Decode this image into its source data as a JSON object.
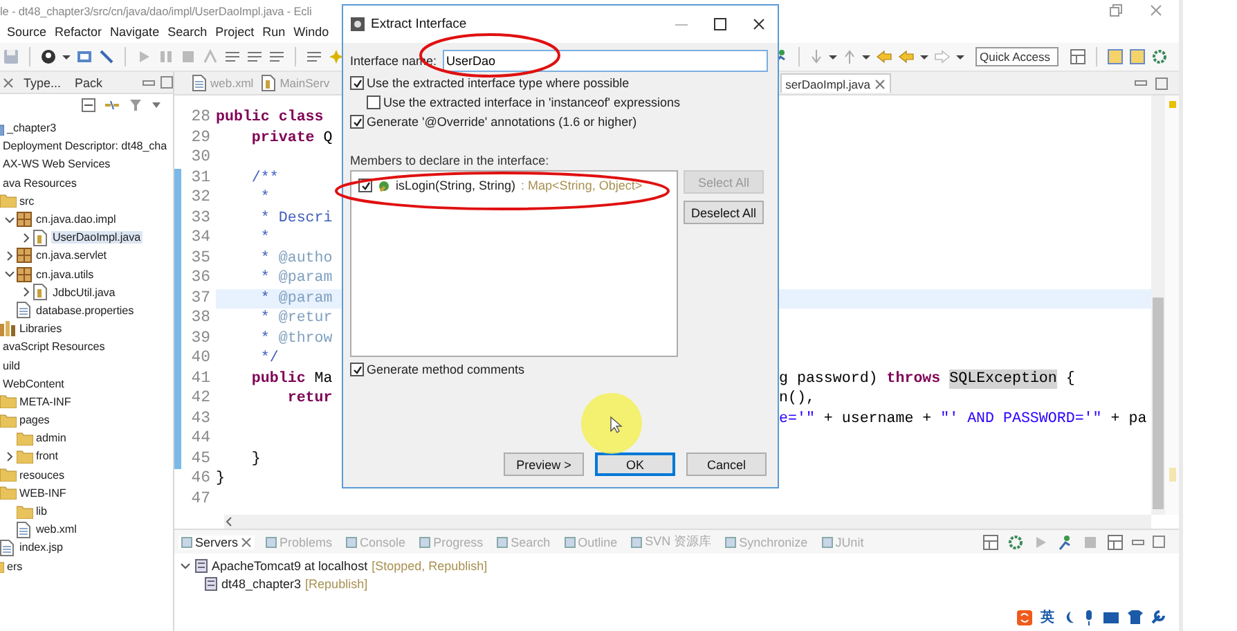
{
  "window": {
    "title": "le - dt48_chapter3/src/cn/java/dao/impl/UserDaoImpl.java - Ecli"
  },
  "menu": [
    "Source",
    "Refactor",
    "Navigate",
    "Search",
    "Project",
    "Run",
    "Windo"
  ],
  "toolbar": {
    "quick_access": {
      "placeholder": "Quick Access"
    }
  },
  "explorer": {
    "tabs": [
      {
        "label": "Type...",
        "selected": false
      },
      {
        "label": "Pack",
        "selected": false
      }
    ],
    "tree": [
      {
        "label": "_chapter3",
        "kind": "project",
        "selected": false,
        "children": [
          {
            "label": "Deployment Descriptor: dt48_cha",
            "selected": false
          },
          {
            "label": "AX-WS Web Services",
            "selected": false
          },
          {
            "label": "ava Resources",
            "selected": false,
            "children": [
              {
                "label": "src",
                "kind": "folder",
                "selected": false,
                "children": [
                  {
                    "label": "cn.java.dao.impl",
                    "kind": "package",
                    "expanded": true,
                    "selected": false,
                    "children": [
                      {
                        "label": "UserDaoImpl.java",
                        "kind": "java",
                        "expanded": false,
                        "selected": true
                      }
                    ]
                  },
                  {
                    "label": "cn.java.servlet",
                    "kind": "package",
                    "expanded": false,
                    "selected": false
                  },
                  {
                    "label": "cn.java.utils",
                    "kind": "package",
                    "expanded": true,
                    "selected": false,
                    "children": [
                      {
                        "label": "JdbcUtil.java",
                        "kind": "java",
                        "expanded": false,
                        "selected": false
                      }
                    ]
                  },
                  {
                    "label": "database.properties",
                    "kind": "document",
                    "selected": false
                  }
                ]
              },
              {
                "label": "Libraries",
                "kind": "library",
                "selected": false
              }
            ]
          },
          {
            "label": "avaScript Resources",
            "selected": false
          },
          {
            "label": "uild",
            "selected": false
          },
          {
            "label": "WebContent",
            "selected": false,
            "children": [
              {
                "label": "META-INF",
                "kind": "folder",
                "selected": false
              },
              {
                "label": "pages",
                "kind": "folder",
                "selected": false,
                "children": [
                  {
                    "label": "admin",
                    "kind": "folder",
                    "selected": false
                  },
                  {
                    "label": "front",
                    "kind": "folder",
                    "expanded": false,
                    "selected": false
                  }
                ]
              },
              {
                "label": "resouces",
                "kind": "folder",
                "selected": false
              },
              {
                "label": "WEB-INF",
                "kind": "folder",
                "selected": false,
                "children": [
                  {
                    "label": "lib",
                    "kind": "folder",
                    "selected": false
                  },
                  {
                    "label": "web.xml",
                    "kind": "document",
                    "selected": false
                  }
                ]
              },
              {
                "label": "index.jsp",
                "kind": "document",
                "selected": false
              }
            ]
          }
        ]
      },
      {
        "label": "ers",
        "kind": "folder",
        "selected": false
      }
    ]
  },
  "editor": {
    "tabs": [
      {
        "label": "web.xml",
        "selected": false
      },
      {
        "label": "MainServ",
        "selected": false
      },
      {
        "label": "serDaoImpl.java",
        "selected": true
      }
    ],
    "lines": [
      {
        "number": "28",
        "changed": false,
        "current": false,
        "left": [
          {
            "kind": "keyword",
            "text": "public class"
          }
        ]
      },
      {
        "number": "29",
        "changed": false,
        "current": false,
        "left": [
          {
            "kind": "keyword",
            "text": "    private"
          },
          {
            "kind": "plain",
            "text": " Q"
          }
        ]
      },
      {
        "number": "30",
        "changed": false,
        "current": false
      },
      {
        "number": "31",
        "changed": true,
        "current": false,
        "left": [
          {
            "kind": "javadoc",
            "text": "    /**"
          }
        ]
      },
      {
        "number": "32",
        "changed": true,
        "current": false,
        "left": [
          {
            "kind": "javadoc",
            "text": "     *"
          }
        ]
      },
      {
        "number": "33",
        "changed": true,
        "current": false,
        "left": [
          {
            "kind": "javadoc",
            "text": "     * Descri"
          }
        ]
      },
      {
        "number": "34",
        "changed": true,
        "current": false,
        "left": [
          {
            "kind": "javadoc",
            "text": "     *"
          }
        ]
      },
      {
        "number": "35",
        "changed": true,
        "current": false,
        "left": [
          {
            "kind": "javadoc",
            "text": "     * "
          },
          {
            "kind": "tag",
            "text": "@autho"
          }
        ]
      },
      {
        "number": "36",
        "changed": true,
        "current": false,
        "left": [
          {
            "kind": "javadoc",
            "text": "     * "
          },
          {
            "kind": "tag",
            "text": "@param"
          }
        ]
      },
      {
        "number": "37",
        "changed": true,
        "current": true,
        "left": [
          {
            "kind": "javadoc",
            "text": "     * "
          },
          {
            "kind": "tag",
            "text": "@param"
          }
        ]
      },
      {
        "number": "38",
        "changed": true,
        "current": false,
        "left": [
          {
            "kind": "javadoc",
            "text": "     * "
          },
          {
            "kind": "tag",
            "text": "@retur"
          }
        ]
      },
      {
        "number": "39",
        "changed": true,
        "current": false,
        "left": [
          {
            "kind": "javadoc",
            "text": "     * "
          },
          {
            "kind": "tag",
            "text": "@throw"
          }
        ]
      },
      {
        "number": "40",
        "changed": true,
        "current": false,
        "left": [
          {
            "kind": "javadoc",
            "text": "     */"
          }
        ]
      },
      {
        "number": "41",
        "changed": true,
        "current": false,
        "left": [
          {
            "kind": "keyword",
            "text": "    public"
          },
          {
            "kind": "plain",
            "text": " Ma"
          }
        ],
        "right": [
          {
            "kind": "plain",
            "text": "g password) "
          },
          {
            "kind": "keyword",
            "text": "throws "
          },
          {
            "kind": "marked",
            "text": "SQLException"
          },
          {
            "kind": "plain",
            "text": " {"
          }
        ]
      },
      {
        "number": "42",
        "changed": true,
        "current": false,
        "left": [
          {
            "kind": "keyword",
            "text": "        retur"
          }
        ],
        "right": [
          {
            "kind": "plain",
            "text": "n(),"
          }
        ]
      },
      {
        "number": "43",
        "changed": true,
        "current": false,
        "right": [
          {
            "kind": "string",
            "text": "e='\""
          },
          {
            "kind": "plain",
            "text": " + username + "
          },
          {
            "kind": "string",
            "text": "\"' AND PASSWORD='\""
          },
          {
            "kind": "plain",
            "text": " + pa"
          }
        ]
      },
      {
        "number": "44",
        "changed": true,
        "current": false
      },
      {
        "number": "45",
        "changed": true,
        "current": false,
        "left": [
          {
            "kind": "plain",
            "text": "    }"
          }
        ]
      },
      {
        "number": "46",
        "changed": false,
        "current": false,
        "left": [
          {
            "kind": "plain",
            "text": "}"
          }
        ]
      },
      {
        "number": "47",
        "changed": false,
        "current": false
      }
    ]
  },
  "dialog": {
    "title": "Extract Interface",
    "name_label": "Interface name:",
    "name_value": "UserDao",
    "options": [
      {
        "label": "Use the extracted interface type where possible",
        "checked": true,
        "children": [
          {
            "label": "Use the extracted interface in 'instanceof' expressions",
            "checked": false
          }
        ]
      },
      {
        "label": "Generate '@Override' annotations (1.6 or higher)",
        "checked": true
      }
    ],
    "members_label": "Members to declare in the interface:",
    "members": [
      {
        "signature": "isLogin(String, String)",
        "return_type": ": Map<String, Object>",
        "checked": true
      }
    ],
    "side_buttons": [
      {
        "label": "Select All",
        "disabled": true
      },
      {
        "label": "Deselect All",
        "disabled": false
      }
    ],
    "comments_option": {
      "label": "Generate method comments",
      "checked": true
    },
    "buttons": [
      {
        "label": "Preview >",
        "default": false
      },
      {
        "label": "OK",
        "default": true
      },
      {
        "label": "Cancel",
        "default": false
      }
    ]
  },
  "servers_view": {
    "tabs": [
      {
        "label": "Servers",
        "selected": true
      },
      {
        "label": "Problems",
        "selected": false
      },
      {
        "label": "Console",
        "selected": false
      },
      {
        "label": "Progress",
        "selected": false
      },
      {
        "label": "Search",
        "selected": false
      },
      {
        "label": "Outline",
        "selected": false
      },
      {
        "label": "SVN 资源库",
        "selected": false
      },
      {
        "label": "Synchronize",
        "selected": false
      },
      {
        "label": "JUnit",
        "selected": false
      }
    ],
    "tree": [
      {
        "label": "ApacheTomcat9 at localhost",
        "status": "[Stopped, Republish]",
        "expanded": true,
        "children": [
          {
            "label": "dt48_chapter3",
            "status": "[Republish]"
          }
        ]
      }
    ]
  },
  "tray": {
    "input_language": "英"
  }
}
